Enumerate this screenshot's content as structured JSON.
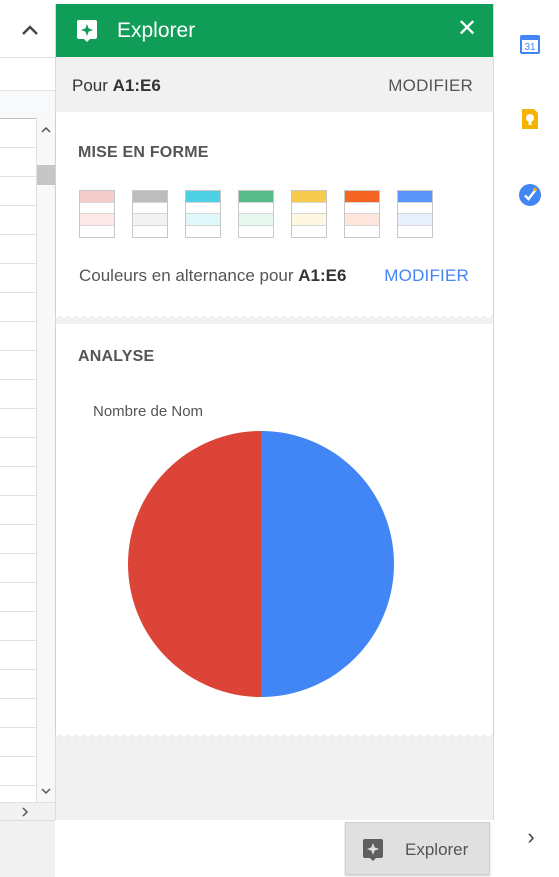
{
  "header": {
    "title": "Explorer",
    "close_icon": "close-icon"
  },
  "range": {
    "prefix": "Pour",
    "range": "A1:E6",
    "modify_label": "MODIFIER"
  },
  "format": {
    "title": "MISE EN FORME",
    "swatches": [
      {
        "name": "red",
        "header": "#f4cccc",
        "band": "#fce8e6"
      },
      {
        "name": "gray",
        "header": "#bdbdbd",
        "band": "#f3f3f3"
      },
      {
        "name": "cyan",
        "header": "#4dd0e1",
        "band": "#e0f7fa"
      },
      {
        "name": "green",
        "header": "#57bb8a",
        "band": "#e7f9ef"
      },
      {
        "name": "yellow",
        "header": "#f7cb4d",
        "band": "#fef8e3"
      },
      {
        "name": "orange",
        "header": "#f46524",
        "band": "#ffe6dd"
      },
      {
        "name": "blue",
        "header": "#5b95f9",
        "band": "#e8f0fe"
      }
    ],
    "alt_text": "Couleurs en alternance pour",
    "alt_range": "A1:E6",
    "modify_label": "MODIFIER"
  },
  "analysis": {
    "title": "ANALYSE"
  },
  "chart_data": {
    "type": "pie",
    "title": "Nombre de Nom",
    "values": [
      50,
      50
    ],
    "colors": [
      "#4285f4",
      "#db4437"
    ]
  },
  "side_icons": [
    "calendar-icon",
    "keep-icon",
    "tasks-icon"
  ],
  "calendar_day": "31",
  "explore_button": {
    "label": "Explorer"
  },
  "colors": {
    "header_green": "#0f9d58",
    "link_blue": "#4285f4"
  }
}
